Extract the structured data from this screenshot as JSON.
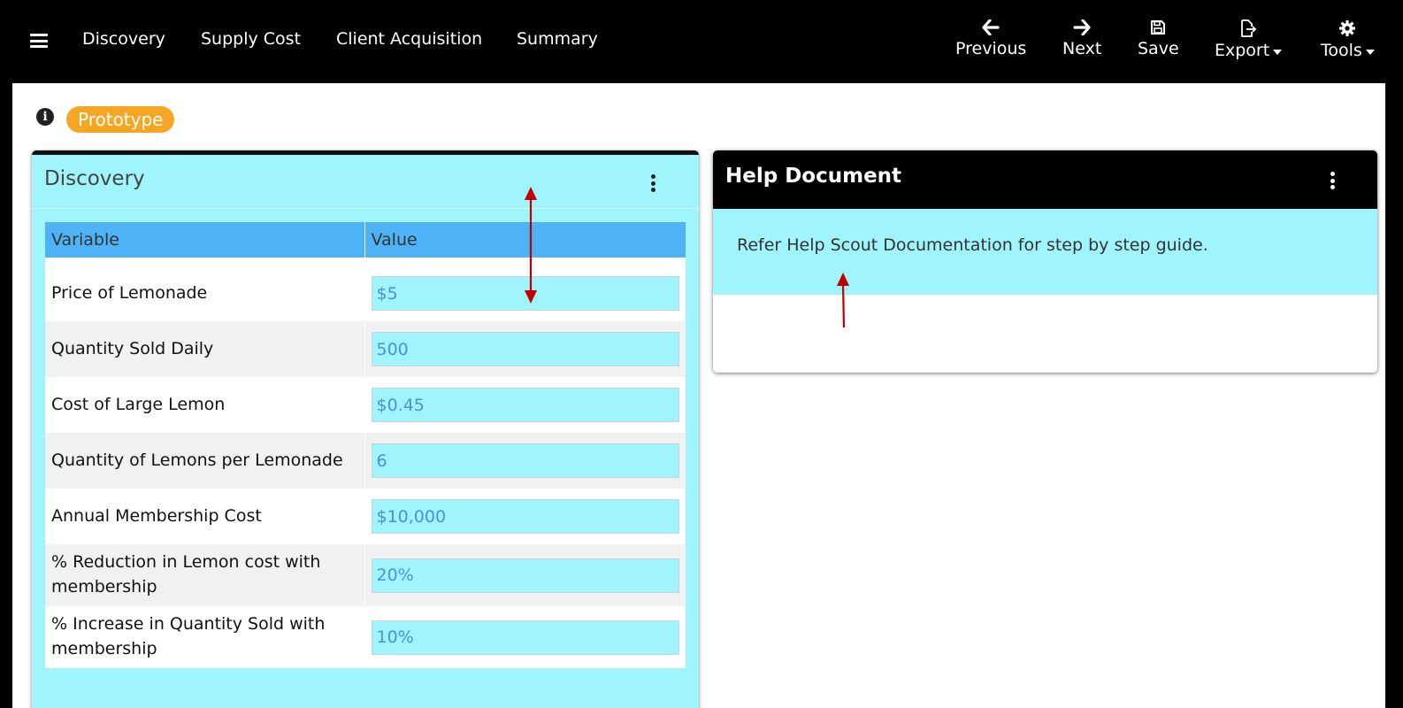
{
  "nav": {
    "links": [
      "Discovery",
      "Supply Cost",
      "Client Acquisition",
      "Summary"
    ],
    "tools": {
      "previous": "Previous",
      "next": "Next",
      "save": "Save",
      "export": "Export",
      "tools": "Tools"
    }
  },
  "status": {
    "badge": "Prototype"
  },
  "discovery": {
    "title": "Discovery",
    "columns": [
      "Variable",
      "Value"
    ],
    "rows": [
      {
        "variable": "Price of Lemonade",
        "value": "$5"
      },
      {
        "variable": "Quantity Sold Daily",
        "value": "500"
      },
      {
        "variable": "Cost of Large Lemon",
        "value": "$0.45"
      },
      {
        "variable": "Quantity of Lemons per Lemonade",
        "value": "6"
      },
      {
        "variable": "Annual Membership Cost",
        "value": "$10,000"
      },
      {
        "variable": "% Reduction in Lemon cost with membership",
        "value": "20%"
      },
      {
        "variable": "% Increase in Quantity Sold with membership",
        "value": "10%"
      }
    ]
  },
  "help": {
    "title": "Help Document",
    "text": "Refer Help Scout Documentation for step by step guide."
  },
  "colors": {
    "accent_cyan": "#9ff5fb",
    "header_blue": "#4db3f6",
    "badge_orange": "#f5a623",
    "value_text": "#4a90e2",
    "annotation_red": "#c00000"
  }
}
